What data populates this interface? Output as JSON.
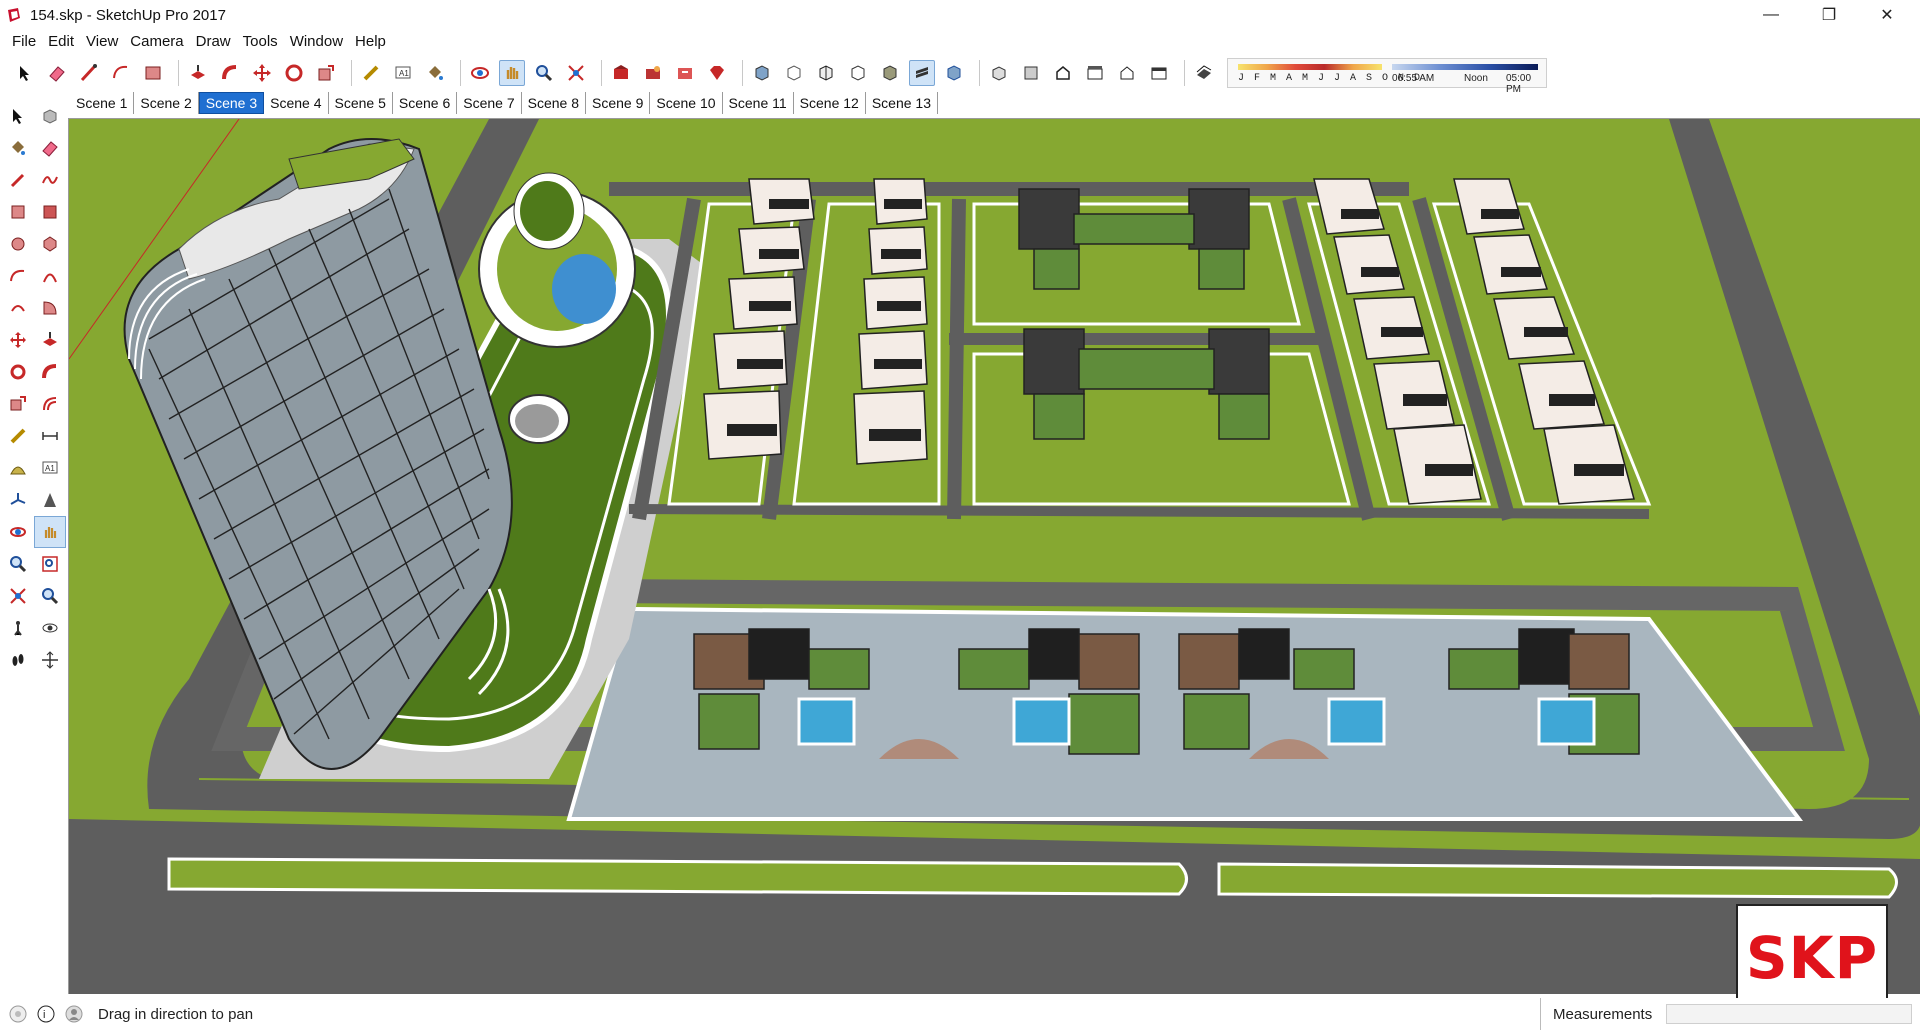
{
  "window": {
    "title": "154.skp - SketchUp Pro 2017",
    "min_glyph": "—",
    "max_glyph": "❐",
    "close_glyph": "✕"
  },
  "menu": [
    "File",
    "Edit",
    "View",
    "Camera",
    "Draw",
    "Tools",
    "Window",
    "Help"
  ],
  "toolbar": {
    "shadow_months": "J F M A M J J A S O N D",
    "shadow_time_start": "06:55 AM",
    "shadow_time_noon": "Noon",
    "shadow_time_end": "05:00 PM"
  },
  "scenes": {
    "tabs": [
      "Scene 1",
      "Scene 2",
      "Scene 3",
      "Scene 4",
      "Scene 5",
      "Scene 6",
      "Scene 7",
      "Scene 8",
      "Scene 9",
      "Scene 10",
      "Scene 11",
      "Scene 12",
      "Scene 13"
    ],
    "active": "Scene 3"
  },
  "badge": {
    "text": "SKP",
    "color": "#e0131b"
  },
  "status": {
    "text": "Drag in direction to pan",
    "measurements_label": "Measurements"
  },
  "colors": {
    "lawn": "#86a831",
    "road": "#5b5b5b",
    "sidewalk": "#c7c7c7",
    "pool": "#3fa7d6",
    "tab_active": "#1f6fd1"
  }
}
